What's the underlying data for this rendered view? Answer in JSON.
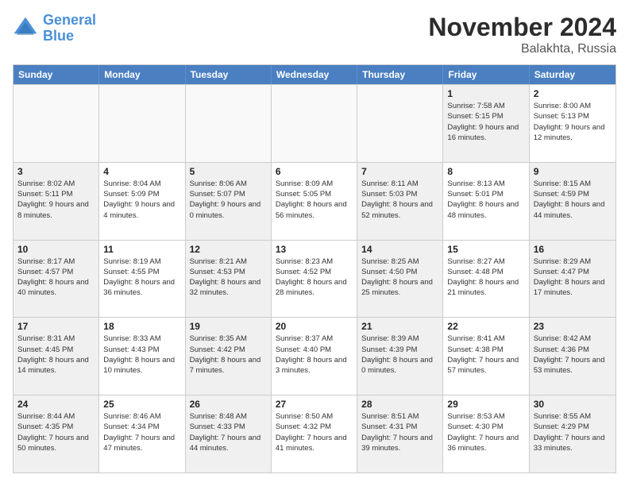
{
  "logo": {
    "line1": "General",
    "line2": "Blue"
  },
  "title": "November 2024",
  "subtitle": "Balakhta, Russia",
  "header_days": [
    "Sunday",
    "Monday",
    "Tuesday",
    "Wednesday",
    "Thursday",
    "Friday",
    "Saturday"
  ],
  "weeks": [
    [
      {
        "day": "",
        "info": "",
        "empty": true
      },
      {
        "day": "",
        "info": "",
        "empty": true
      },
      {
        "day": "",
        "info": "",
        "empty": true
      },
      {
        "day": "",
        "info": "",
        "empty": true
      },
      {
        "day": "",
        "info": "",
        "empty": true
      },
      {
        "day": "1",
        "info": "Sunrise: 7:58 AM\nSunset: 5:15 PM\nDaylight: 9 hours and 16 minutes.",
        "shaded": true
      },
      {
        "day": "2",
        "info": "Sunrise: 8:00 AM\nSunset: 5:13 PM\nDaylight: 9 hours and 12 minutes.",
        "shaded": false
      }
    ],
    [
      {
        "day": "3",
        "info": "Sunrise: 8:02 AM\nSunset: 5:11 PM\nDaylight: 9 hours and 8 minutes.",
        "shaded": true
      },
      {
        "day": "4",
        "info": "Sunrise: 8:04 AM\nSunset: 5:09 PM\nDaylight: 9 hours and 4 minutes.",
        "shaded": false
      },
      {
        "day": "5",
        "info": "Sunrise: 8:06 AM\nSunset: 5:07 PM\nDaylight: 9 hours and 0 minutes.",
        "shaded": true
      },
      {
        "day": "6",
        "info": "Sunrise: 8:09 AM\nSunset: 5:05 PM\nDaylight: 8 hours and 56 minutes.",
        "shaded": false
      },
      {
        "day": "7",
        "info": "Sunrise: 8:11 AM\nSunset: 5:03 PM\nDaylight: 8 hours and 52 minutes.",
        "shaded": true
      },
      {
        "day": "8",
        "info": "Sunrise: 8:13 AM\nSunset: 5:01 PM\nDaylight: 8 hours and 48 minutes.",
        "shaded": false
      },
      {
        "day": "9",
        "info": "Sunrise: 8:15 AM\nSunset: 4:59 PM\nDaylight: 8 hours and 44 minutes.",
        "shaded": true
      }
    ],
    [
      {
        "day": "10",
        "info": "Sunrise: 8:17 AM\nSunset: 4:57 PM\nDaylight: 8 hours and 40 minutes.",
        "shaded": true
      },
      {
        "day": "11",
        "info": "Sunrise: 8:19 AM\nSunset: 4:55 PM\nDaylight: 8 hours and 36 minutes.",
        "shaded": false
      },
      {
        "day": "12",
        "info": "Sunrise: 8:21 AM\nSunset: 4:53 PM\nDaylight: 8 hours and 32 minutes.",
        "shaded": true
      },
      {
        "day": "13",
        "info": "Sunrise: 8:23 AM\nSunset: 4:52 PM\nDaylight: 8 hours and 28 minutes.",
        "shaded": false
      },
      {
        "day": "14",
        "info": "Sunrise: 8:25 AM\nSunset: 4:50 PM\nDaylight: 8 hours and 25 minutes.",
        "shaded": true
      },
      {
        "day": "15",
        "info": "Sunrise: 8:27 AM\nSunset: 4:48 PM\nDaylight: 8 hours and 21 minutes.",
        "shaded": false
      },
      {
        "day": "16",
        "info": "Sunrise: 8:29 AM\nSunset: 4:47 PM\nDaylight: 8 hours and 17 minutes.",
        "shaded": true
      }
    ],
    [
      {
        "day": "17",
        "info": "Sunrise: 8:31 AM\nSunset: 4:45 PM\nDaylight: 8 hours and 14 minutes.",
        "shaded": true
      },
      {
        "day": "18",
        "info": "Sunrise: 8:33 AM\nSunset: 4:43 PM\nDaylight: 8 hours and 10 minutes.",
        "shaded": false
      },
      {
        "day": "19",
        "info": "Sunrise: 8:35 AM\nSunset: 4:42 PM\nDaylight: 8 hours and 7 minutes.",
        "shaded": true
      },
      {
        "day": "20",
        "info": "Sunrise: 8:37 AM\nSunset: 4:40 PM\nDaylight: 8 hours and 3 minutes.",
        "shaded": false
      },
      {
        "day": "21",
        "info": "Sunrise: 8:39 AM\nSunset: 4:39 PM\nDaylight: 8 hours and 0 minutes.",
        "shaded": true
      },
      {
        "day": "22",
        "info": "Sunrise: 8:41 AM\nSunset: 4:38 PM\nDaylight: 7 hours and 57 minutes.",
        "shaded": false
      },
      {
        "day": "23",
        "info": "Sunrise: 8:42 AM\nSunset: 4:36 PM\nDaylight: 7 hours and 53 minutes.",
        "shaded": true
      }
    ],
    [
      {
        "day": "24",
        "info": "Sunrise: 8:44 AM\nSunset: 4:35 PM\nDaylight: 7 hours and 50 minutes.",
        "shaded": true
      },
      {
        "day": "25",
        "info": "Sunrise: 8:46 AM\nSunset: 4:34 PM\nDaylight: 7 hours and 47 minutes.",
        "shaded": false
      },
      {
        "day": "26",
        "info": "Sunrise: 8:48 AM\nSunset: 4:33 PM\nDaylight: 7 hours and 44 minutes.",
        "shaded": true
      },
      {
        "day": "27",
        "info": "Sunrise: 8:50 AM\nSunset: 4:32 PM\nDaylight: 7 hours and 41 minutes.",
        "shaded": false
      },
      {
        "day": "28",
        "info": "Sunrise: 8:51 AM\nSunset: 4:31 PM\nDaylight: 7 hours and 39 minutes.",
        "shaded": true
      },
      {
        "day": "29",
        "info": "Sunrise: 8:53 AM\nSunset: 4:30 PM\nDaylight: 7 hours and 36 minutes.",
        "shaded": false
      },
      {
        "day": "30",
        "info": "Sunrise: 8:55 AM\nSunset: 4:29 PM\nDaylight: 7 hours and 33 minutes.",
        "shaded": true
      }
    ]
  ]
}
